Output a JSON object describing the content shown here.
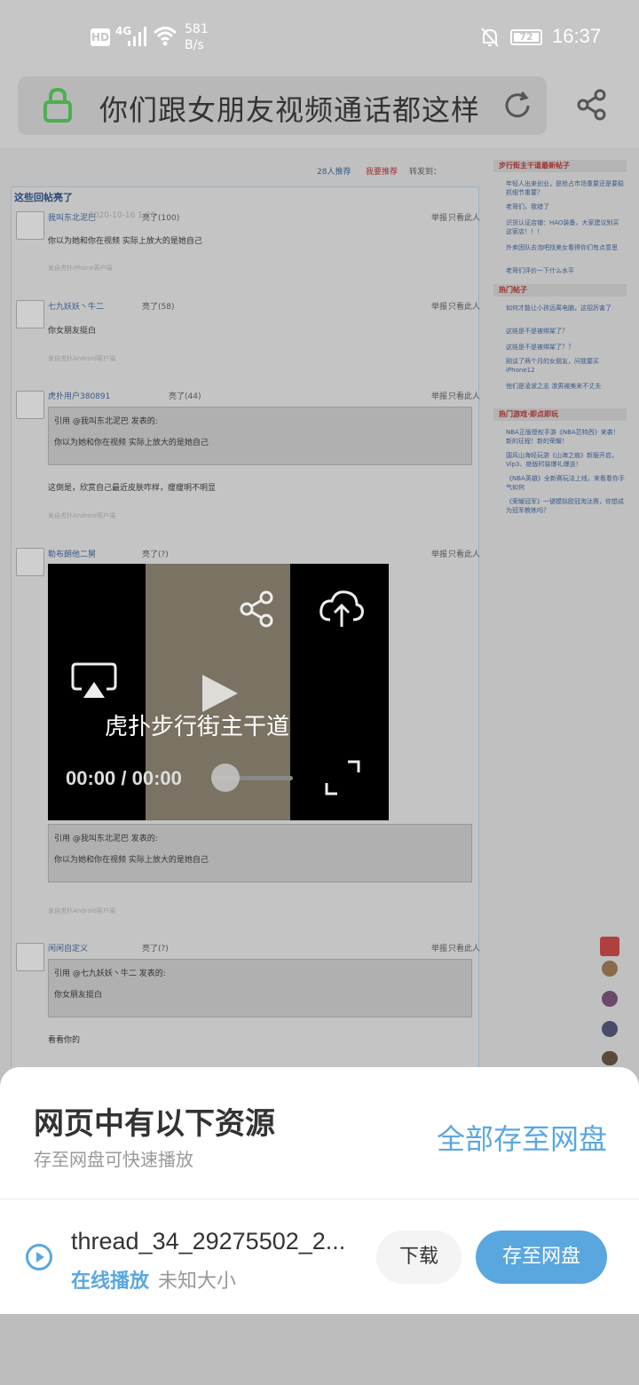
{
  "status": {
    "hd": "HD",
    "network": "4G",
    "speed_value": "581",
    "speed_unit": "B/s",
    "battery": "72",
    "time": "16:37"
  },
  "urlbar": {
    "title": "你们跟女朋友视频通话都这样"
  },
  "webpage": {
    "top_links": [
      "28人推荐",
      "我要推荐",
      "转发到："
    ],
    "section_title": "这些回帖亮了",
    "posts": [
      {
        "user": "我叫东北泥巴",
        "meta": "2020-10-16 1:20",
        "light": "亮了(100)",
        "text": "你以为她和你在视频 实际上放大的是她自己",
        "source": "发自虎扑iPhone客户端"
      },
      {
        "user": "七九妖妖丶牛二",
        "meta": "2020-10-16 1:37",
        "light": "亮了(58)",
        "text": "你女朋友挺白",
        "source": "发自虎扑Android客户端"
      },
      {
        "user": "虎扑用户380891",
        "meta": "2020-10-16 11:20",
        "light": "亮了(44)",
        "quote_user": "引用 @我叫东北泥巴 发表的:",
        "quote_text": "你以为她和你在视频 实际上放大的是她自己",
        "text": "这倒是，欣赏自己最近皮肤咋样，瘦瘦明不明显",
        "source": "发自虎扑Android客户端"
      },
      {
        "user": "勒布朗他二舅",
        "meta": "2020-10-16 12:09",
        "light": "亮了(?)",
        "quote_user": "引用 @我叫东北泥巴 发表的:",
        "quote_text": "你以为她和你在视频 实际上放大的是她自己",
        "source": "发自虎扑Android客户端"
      },
      {
        "user": "闲闲自定义",
        "meta": "2020-10-16 12:48",
        "light": "亮了(?)",
        "quote_user": "引用 @七九妖妖丶牛二 发表的:",
        "quote_text": "你女朋友挺白",
        "text": "看看你的"
      }
    ],
    "post_actions": [
      "举报",
      "只看此人"
    ],
    "sidebar": {
      "sections": [
        {
          "title": "步行街主干道最新帖子",
          "items": [
            "年轻人出来创业，是抢占市场重要还是要稳抓细节重要？",
            "老哥们，我错了",
            "识货认证店铺：HAO装备，大家建议别买这家店！！！",
            "外卖团队去泡吧找美女看得你们有点意思",
            "老哥们评价一下什么水平"
          ]
        },
        {
          "title": "热门帖子",
          "items": [
            "如何才能让小孩远离电脑，这招厉害了",
            "这娃是不是被绑架了？",
            "这娃是不是被绑架了？？",
            "刚谈了两个月的女朋友，问我要买iPhone12",
            "他们是凌波之志 渣男被美来不丈夫"
          ]
        },
        {
          "title": "热门游戏·即点即玩",
          "items": [
            "NBA正版授权手游《NBA范特西》来袭！新的征程！新的荣耀！",
            "国风山海经玩游《山海之痕》新服开启，Vip3、绝版时装爆礼爆送！",
            "《NBA英雄》全新赛玩法上线，来看看你手气如何",
            "《荣耀冠军》一键模拟欧冠淘汰赛，你想成为冠军教练吗？"
          ]
        }
      ]
    },
    "video": {
      "title": "虎扑步行街主干道",
      "time": "00:00 / 00:00",
      "progress": 0
    }
  },
  "sheet": {
    "title": "网页中有以下资源",
    "subtitle": "存至网盘可快速播放",
    "save_all": "全部存至网盘",
    "file": {
      "name": "thread_34_29275502_2...",
      "play_label": "在线播放",
      "size_label": "未知大小"
    },
    "download_label": "下载",
    "save_label": "存至网盘"
  },
  "colors": {
    "accent": "#5aa7e0",
    "lock_green": "#4caf50"
  }
}
